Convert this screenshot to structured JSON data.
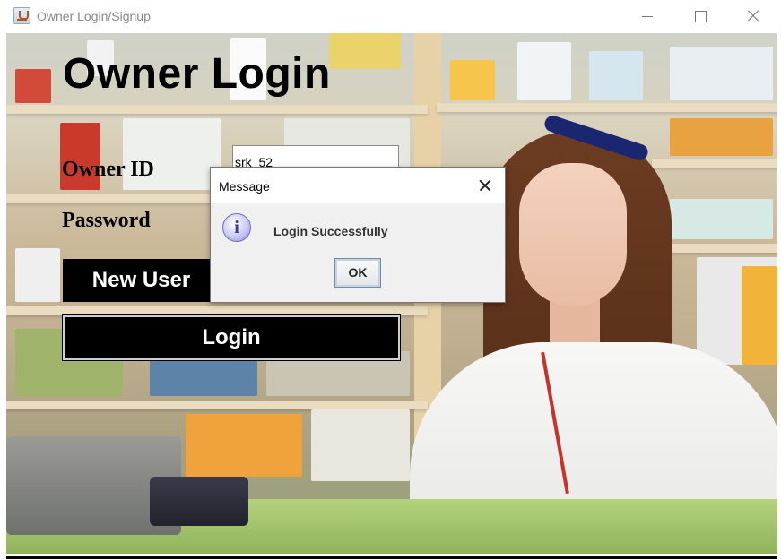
{
  "window": {
    "title": "Owner Login/Signup"
  },
  "form": {
    "heading": "Owner Login",
    "owner_id_label": "Owner ID",
    "password_label": "Password",
    "owner_id_value": "srk_52",
    "new_user_label": "New User",
    "login_label": "Login"
  },
  "dialog": {
    "title": "Message",
    "message": "Login Successfully",
    "ok_label": "OK",
    "icon": "info-icon"
  },
  "colors": {
    "button_bg": "#000000",
    "button_text": "#ffffff",
    "dialog_bg": "#f0f0f0"
  }
}
